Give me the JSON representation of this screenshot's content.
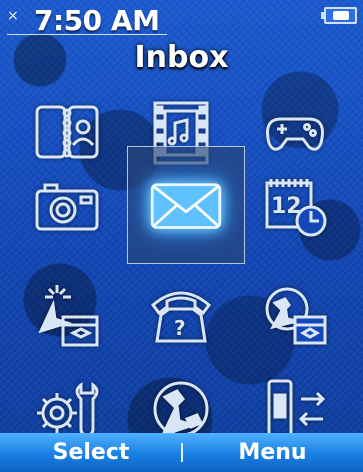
{
  "status": {
    "time": "7:50 AM",
    "signal_glyph": "×"
  },
  "title": "Inbox",
  "menu_items": [
    {
      "icon": "contacts-book-icon"
    },
    {
      "icon": "music-video-icon"
    },
    {
      "icon": "game-controller-icon"
    },
    {
      "icon": "camera-icon"
    },
    {
      "icon": "messaging-envelope-icon",
      "selected": true
    },
    {
      "icon": "calendar-clock-icon"
    },
    {
      "icon": "click-window-icon"
    },
    {
      "icon": "phone-help-icon"
    },
    {
      "icon": "internet-window-icon"
    },
    {
      "icon": "settings-gear-wrench-icon"
    },
    {
      "icon": "internet-globe-icon"
    },
    {
      "icon": "device-transfer-icon"
    }
  ],
  "softkeys": {
    "left": "Select",
    "right": "Menu"
  },
  "colors": {
    "background": "#1548b8",
    "softkey_bar": "#1a7fe3",
    "icon_stroke": "#d9e6f5",
    "selected_glow": "#7ad3ff"
  }
}
